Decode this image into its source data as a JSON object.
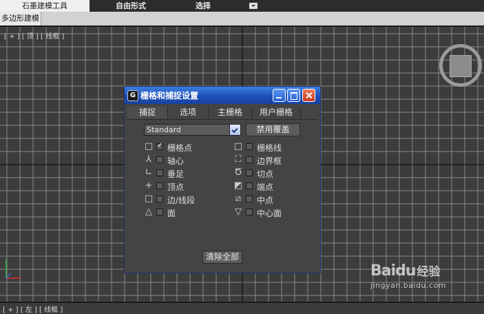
{
  "ribbon": {
    "tabs": [
      {
        "label": "石墨建模工具",
        "active": true
      },
      {
        "label": "自由形式",
        "active": false
      },
      {
        "label": "选择",
        "active": false
      }
    ],
    "panel_label": "多边形建模"
  },
  "viewport": {
    "label": "[ + ] [ 顶 ] [ 线框 ]",
    "bottom_label": "[ + ] [ 左 ] [ 线框 ]"
  },
  "dialog": {
    "title": "栅格和捕捉设置",
    "tabs": [
      "捕捉",
      "选项",
      "主栅格",
      "用户栅格"
    ],
    "active_tab": 0,
    "snap_type_value": "Standard",
    "override_button": "禁用覆盖",
    "options_left": [
      {
        "label": "栅格点",
        "checked": true,
        "icon": "grid-point-icon"
      },
      {
        "label": "轴心",
        "checked": false,
        "icon": "pivot-icon"
      },
      {
        "label": "垂足",
        "checked": false,
        "icon": "perpendicular-icon"
      },
      {
        "label": "顶点",
        "checked": false,
        "icon": "vertex-icon"
      },
      {
        "label": "边/线段",
        "checked": false,
        "icon": "edge-icon"
      },
      {
        "label": "面",
        "checked": false,
        "icon": "face-icon"
      }
    ],
    "options_right": [
      {
        "label": "栅格线",
        "checked": false,
        "icon": "grid-line-icon"
      },
      {
        "label": "边界框",
        "checked": false,
        "icon": "bounding-box-icon"
      },
      {
        "label": "切点",
        "checked": false,
        "icon": "tangent-icon"
      },
      {
        "label": "端点",
        "checked": false,
        "icon": "endpoint-icon"
      },
      {
        "label": "中点",
        "checked": false,
        "icon": "midpoint-icon"
      },
      {
        "label": "中心面",
        "checked": false,
        "icon": "center-face-icon"
      }
    ],
    "clear_all_button": "清除全部"
  },
  "watermark": {
    "logo": "Baidu",
    "brand": "经验",
    "url": "jingyan.baidu.com"
  }
}
